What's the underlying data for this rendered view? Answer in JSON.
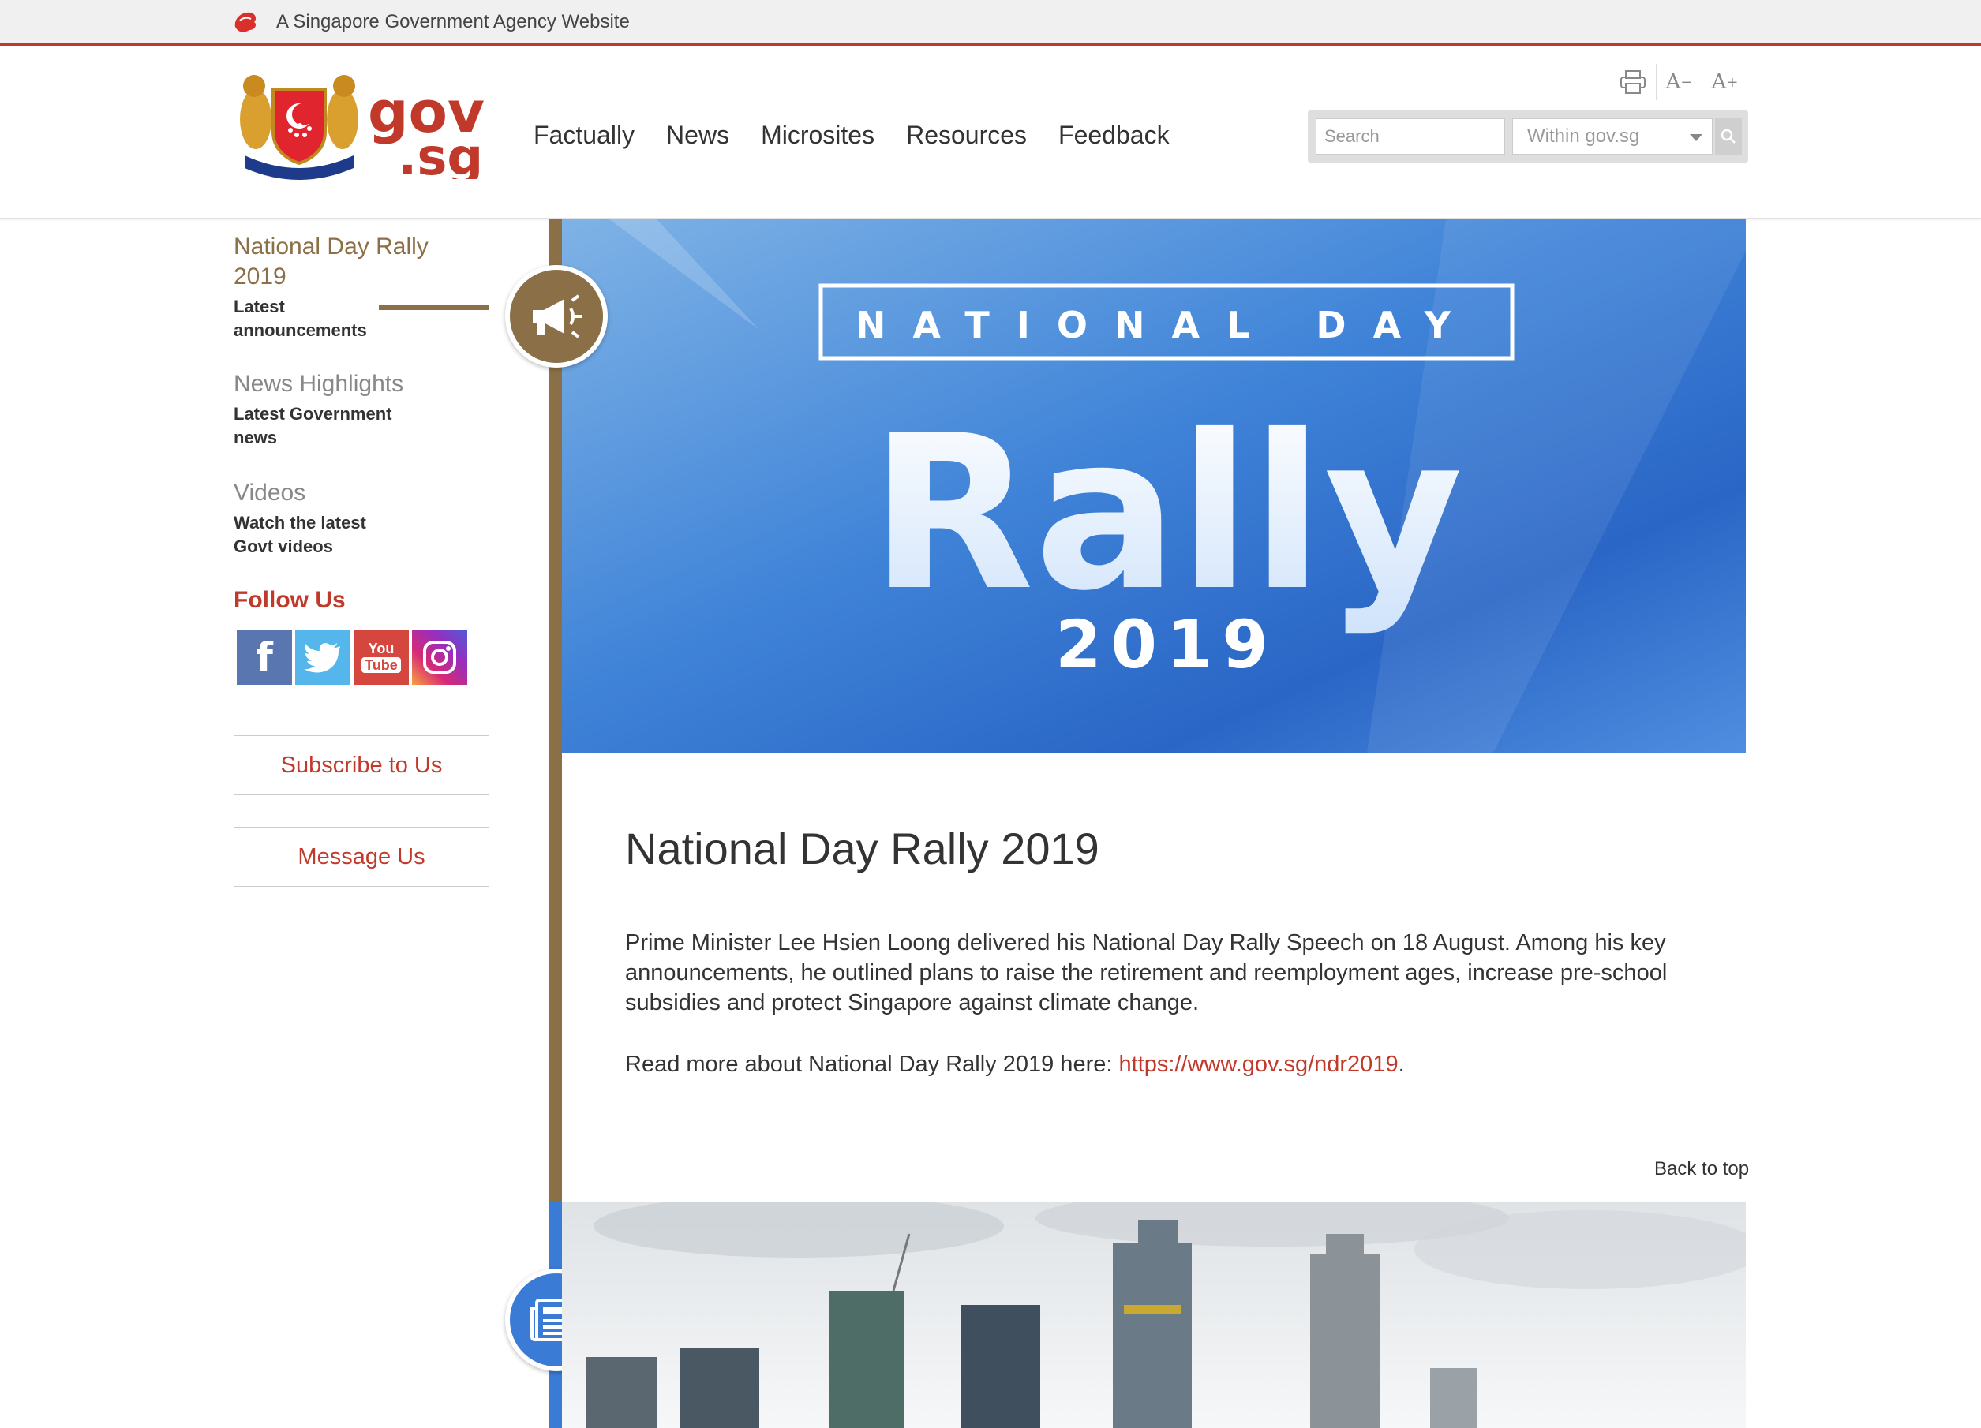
{
  "masthead": {
    "agency_text": "A Singapore Government Agency Website"
  },
  "header": {
    "logo_text_1": "gov",
    "logo_text_2": ".sg",
    "nav": [
      "Factually",
      "News",
      "Microsites",
      "Resources",
      "Feedback"
    ],
    "tools": {
      "print_icon": "print-icon",
      "decrease_text": "A",
      "decrease_sup": "−",
      "increase_text": "A",
      "increase_sup": "+"
    },
    "search": {
      "placeholder": "Search",
      "scope": "Within gov.sg"
    }
  },
  "sidebar": {
    "sections": [
      {
        "title": "National Day Rally 2019",
        "subtitle": "Latest announcements"
      },
      {
        "title": "News Highlights",
        "subtitle": "Latest Government news"
      },
      {
        "title": "Videos",
        "subtitle": "Watch the latest Govt videos"
      }
    ],
    "follow_label": "Follow Us",
    "social": [
      {
        "icon": "facebook-icon",
        "glyph": "f",
        "color": "#5a76b0"
      },
      {
        "icon": "twitter-icon",
        "glyph": "🐦",
        "color": "#55b6ec"
      },
      {
        "icon": "youtube-icon",
        "glyph": "You Tube",
        "color": "#d5463f"
      },
      {
        "icon": "instagram-icon",
        "glyph": "◎",
        "color": "#b540b0"
      }
    ],
    "subscribe_label": "Subscribe to Us",
    "message_label": "Message Us"
  },
  "banner": {
    "line1": "NATIONAL DAY",
    "line2": "Rally",
    "line3": "2019"
  },
  "article": {
    "title": "National Day Rally 2019",
    "paragraph1": "Prime Minister Lee Hsien Loong delivered his National Day Rally Speech on 18 August. Among his key announcements, he outlined plans to raise the retirement and reemployment ages, increase pre-school subsidies and protect Singapore against climate change.",
    "read_more_prefix": "Read more about National Day Rally 2019 here: ",
    "read_more_link": "https://www.gov.sg/ndr2019",
    "read_more_suffix": "."
  },
  "back_to_top": "Back to top",
  "colors": {
    "brand_red": "#c0392b",
    "brown": "#8b6f47",
    "blue": "#3a7bd5"
  }
}
